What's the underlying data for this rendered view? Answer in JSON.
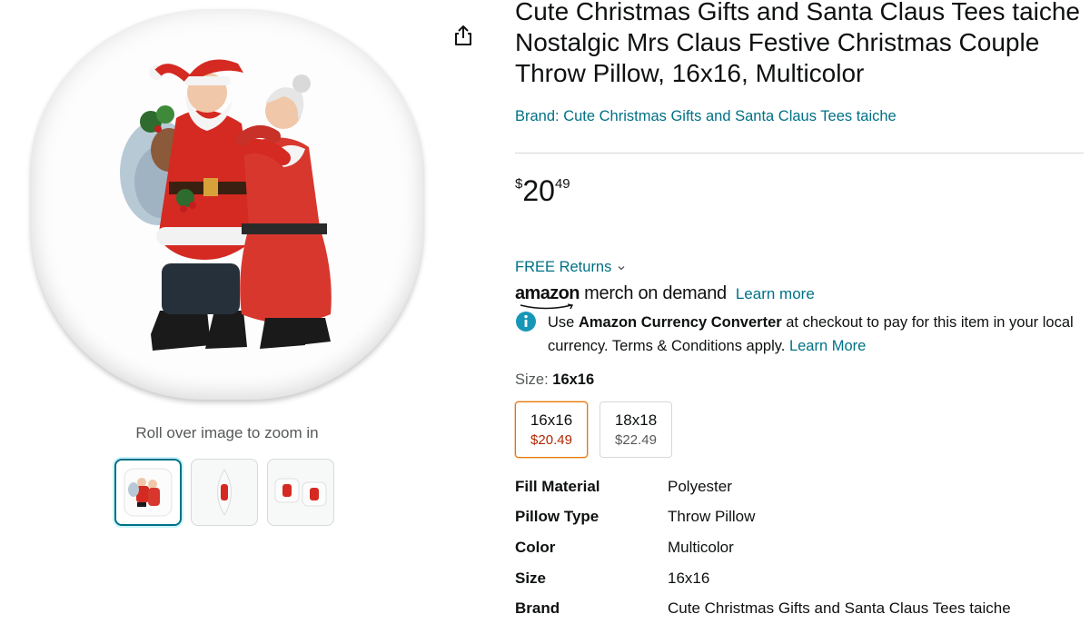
{
  "media": {
    "rollover_hint": "Roll over image to zoom in",
    "thumbnails": [
      "front-view",
      "side-view",
      "pair-view"
    ],
    "share_icon": "share-icon"
  },
  "product": {
    "title": "Cute Christmas Gifts and Santa Claus Tees taiche Nostalgic Mrs Claus Festive Christmas Couple Throw Pillow, 16x16, Multicolor",
    "brand_link": "Brand: Cute Christmas Gifts and Santa Claus Tees taiche"
  },
  "price": {
    "symbol": "$",
    "whole": "20",
    "fraction": "49"
  },
  "returns": {
    "label": "FREE Returns"
  },
  "merch": {
    "logo_amazon": "amazon",
    "logo_rest": "merch on demand",
    "learn_more": "Learn more"
  },
  "currency_note": {
    "prefix": "Use ",
    "bold": "Amazon Currency Converter",
    "suffix": " at checkout to pay for this item in your local currency. Terms & Conditions apply. ",
    "link": "Learn More"
  },
  "size": {
    "label": "Size: ",
    "selected": "16x16",
    "options": [
      {
        "name": "16x16",
        "price": "$20.49"
      },
      {
        "name": "18x18",
        "price": "$22.49"
      }
    ]
  },
  "specs": [
    {
      "key": "Fill Material",
      "value": "Polyester"
    },
    {
      "key": "Pillow Type",
      "value": "Throw Pillow"
    },
    {
      "key": "Color",
      "value": "Multicolor"
    },
    {
      "key": "Size",
      "value": "16x16"
    },
    {
      "key": "Brand",
      "value": "Cute Christmas Gifts and Santa Claus Tees taiche"
    }
  ],
  "colors": {
    "link": "#007185",
    "price_red": "#b12704",
    "selected_border": "#e77600",
    "text": "#0f1111",
    "muted": "#565959"
  }
}
